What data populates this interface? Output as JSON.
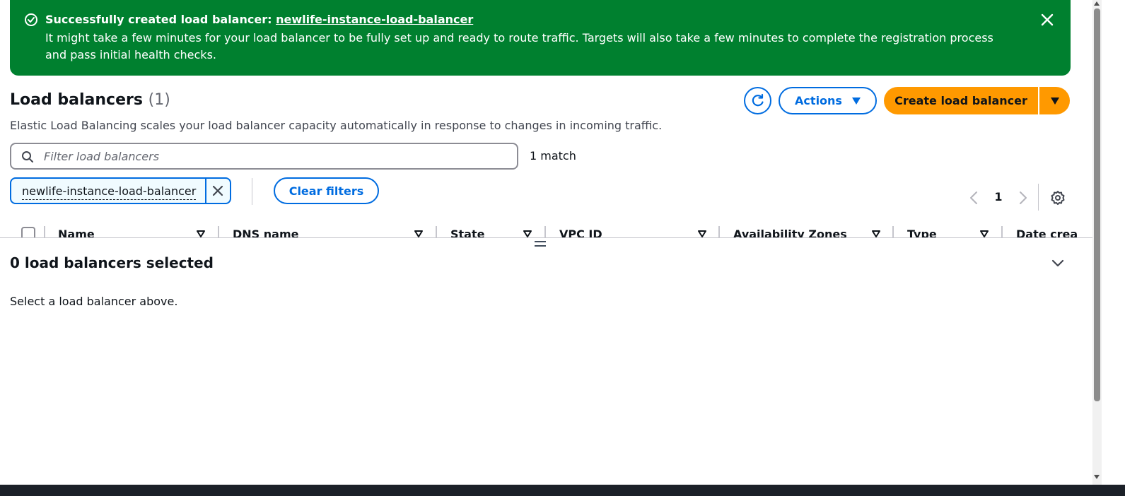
{
  "flash": {
    "title_prefix": "Successfully created load balancer:",
    "title_link": "newlife-instance-load-balancer",
    "message": "It might take a few minutes for your load balancer to be fully set up and ready to route traffic. Targets will also take a few minutes to complete the registration process and pass initial health checks.",
    "type": "success",
    "color": "#00802f",
    "status_icon": "success-check-circle-icon",
    "dismiss_icon": "close-icon"
  },
  "header": {
    "title": "Load balancers",
    "count": "(1)",
    "description": "Elastic Load Balancing scales your load balancer capacity automatically in response to changes in incoming traffic.",
    "refresh_icon": "refresh-icon",
    "actions_label": "Actions",
    "create_label": "Create load balancer",
    "primary_color": "#ff9900",
    "link_color": "#006ce0"
  },
  "filter": {
    "placeholder": "Filter load balancers",
    "value": "",
    "match_count": "1 match",
    "token": "newlife-instance-load-balancer",
    "clear_label": "Clear filters"
  },
  "pagination": {
    "current_page": "1",
    "settings_icon": "gear-icon"
  },
  "table": {
    "columns": [
      "Name",
      "DNS name",
      "State",
      "VPC ID",
      "Availability Zones",
      "Type",
      "Date crea"
    ]
  },
  "details": {
    "title": "0 load balancers selected",
    "empty_text": "Select a load balancer above."
  }
}
